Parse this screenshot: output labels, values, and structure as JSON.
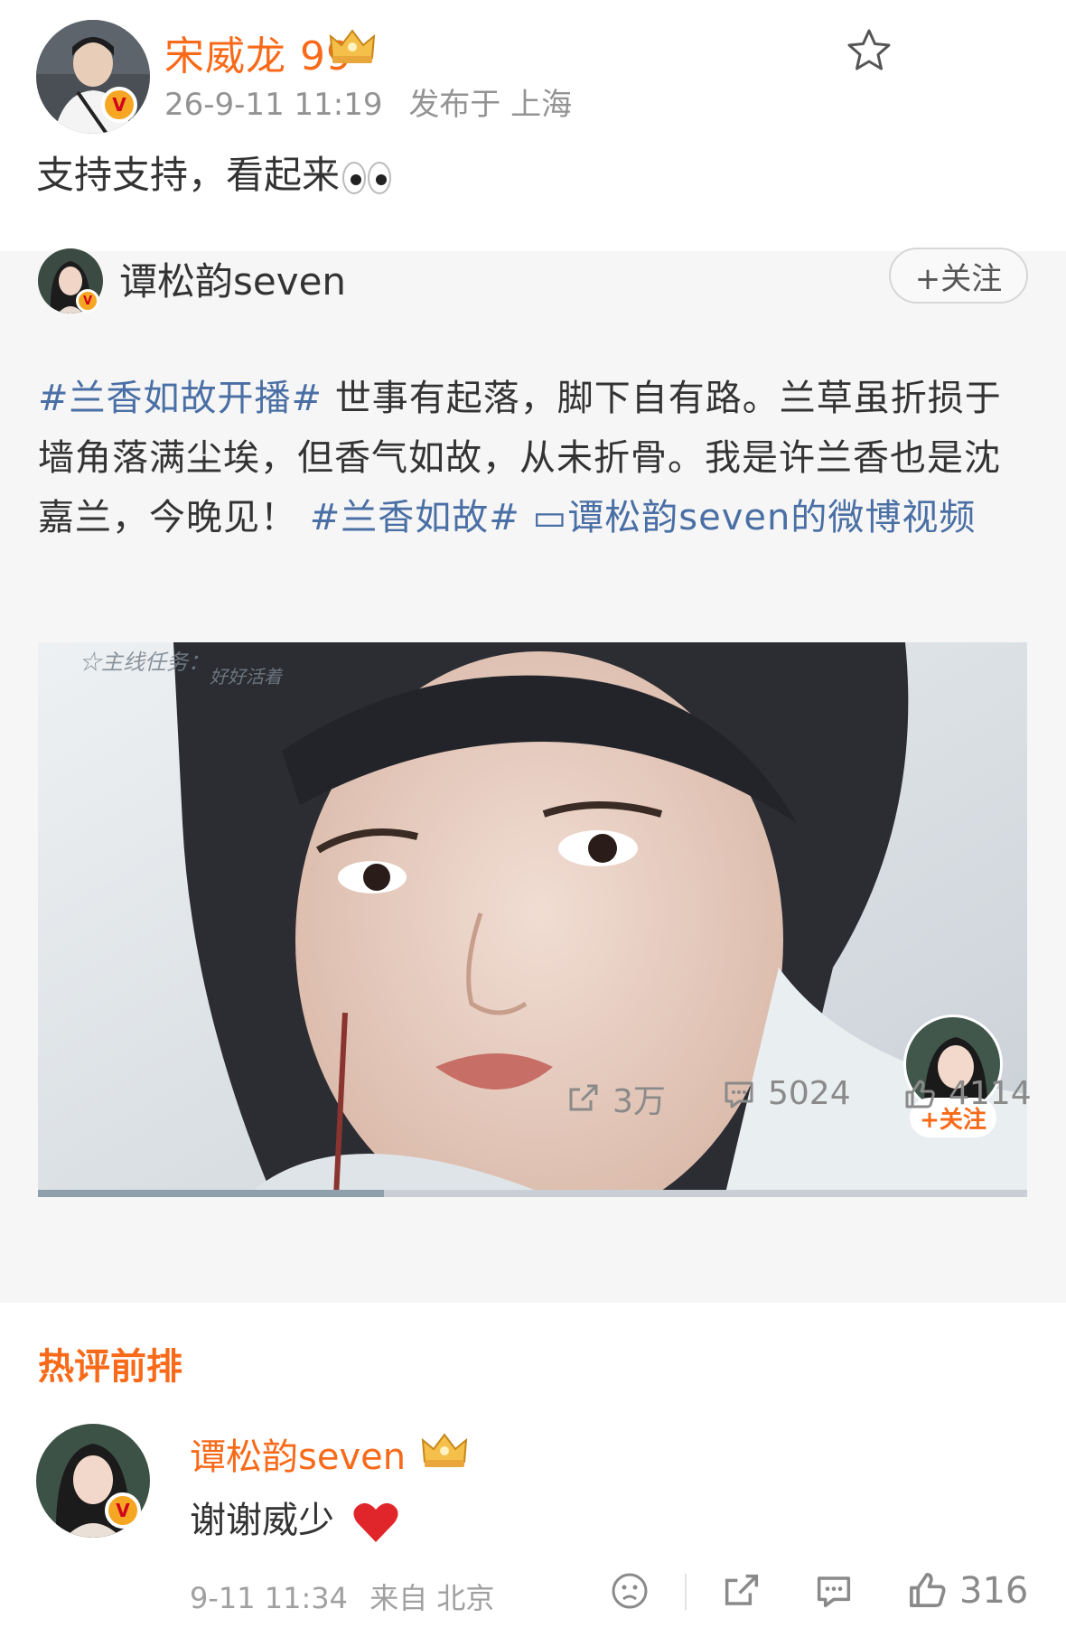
{
  "post": {
    "author": "宋威龙 99",
    "time": "26-9-11 11:19",
    "location": "发布于 上海",
    "text": "支持支持，看起来"
  },
  "repost": {
    "author": "谭松韵seven",
    "follow_label": "+关注",
    "text_parts": [
      {
        "type": "link",
        "text": "#兰香如故开播#"
      },
      {
        "type": "text",
        "text": " 世事有起落，脚下自有路。兰草虽折损于墙角落满尘埃，但香气如故，从未折骨。我是许兰香也是沈嘉兰，今晚见！ "
      },
      {
        "type": "link",
        "text": "#兰香如故#"
      },
      {
        "type": "text",
        "text": " "
      },
      {
        "type": "link",
        "text": "▭谭松韵seven的微博视频"
      }
    ],
    "video": {
      "overlay_line1": "☆主线任务：",
      "overlay_line2": "好好活着",
      "follow_label": "+关注",
      "progress": 0.35
    },
    "stats": {
      "reposts": "3万",
      "comments": "5024",
      "likes": "4114"
    }
  },
  "hot_comments": {
    "title": "热评前排",
    "items": [
      {
        "author": "谭松韵seven",
        "text": "谢谢威少",
        "time": "9-11 11:34",
        "location": "来自 北京",
        "likes": "316"
      }
    ]
  },
  "colors": {
    "accent": "#f86a19",
    "link": "#4a6fa5",
    "card_bg": "#f6f6f6",
    "muted": "#939393"
  }
}
